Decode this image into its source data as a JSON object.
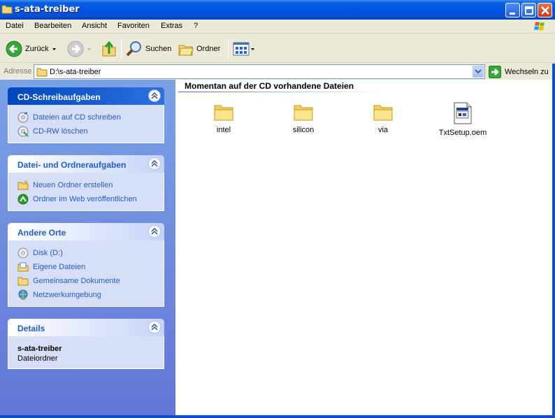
{
  "window": {
    "title": "s-ata-treiber"
  },
  "menu": [
    "Datei",
    "Bearbeiten",
    "Ansicht",
    "Favoriten",
    "Extras",
    "?"
  ],
  "toolbar": {
    "back_label": "Zurück",
    "search_label": "Suchen",
    "folders_label": "Ordner"
  },
  "address": {
    "label": "Adresse",
    "value": "D:\\s-ata-treiber",
    "go_label": "Wechseln zu"
  },
  "panels": {
    "cd": {
      "title": "CD-Schreibaufgaben",
      "tasks": [
        "Dateien auf CD schreiben",
        "CD-RW löschen"
      ]
    },
    "file_tasks": {
      "title": "Datei- und Ordneraufgaben",
      "tasks": [
        "Neuen Ordner erstellen",
        "Ordner im Web veröffentlichen"
      ]
    },
    "other_places": {
      "title": "Andere Orte",
      "places": [
        "Disk (D:)",
        "Eigene Dateien",
        "Gemeinsame Dokumente",
        "Netzwerkumgebung"
      ]
    },
    "details": {
      "title": "Details",
      "name": "s-ata-treiber",
      "type": "Dateiordner"
    }
  },
  "content": {
    "group_header": "Momentan auf der CD vorhandene Dateien",
    "files": [
      {
        "name": "intel",
        "icon": "folder-icon"
      },
      {
        "name": "silicon",
        "icon": "folder-icon"
      },
      {
        "name": "via",
        "icon": "folder-icon"
      },
      {
        "name": "TxtSetup.oem",
        "icon": "setup-file-icon"
      }
    ]
  }
}
